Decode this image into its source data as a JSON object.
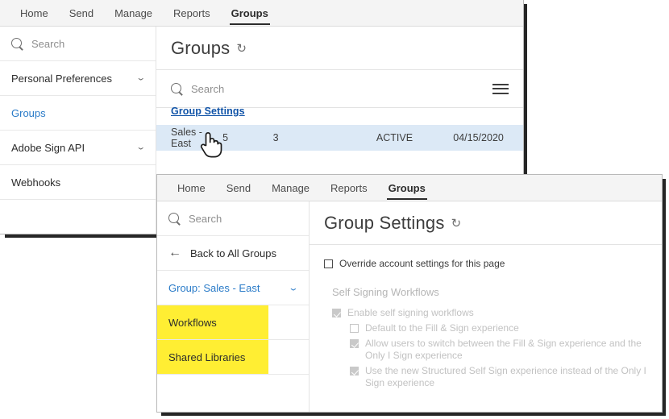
{
  "window_groups": {
    "nav": [
      {
        "label": "Home",
        "active": false
      },
      {
        "label": "Send",
        "active": false
      },
      {
        "label": "Manage",
        "active": false
      },
      {
        "label": "Reports",
        "active": false
      },
      {
        "label": "Groups",
        "active": true
      }
    ],
    "sidebar": {
      "search_placeholder": "Search",
      "items": [
        {
          "label": "Personal Preferences",
          "caret": "⌄",
          "style": "plain"
        },
        {
          "label": "Groups",
          "caret": "",
          "style": "link"
        },
        {
          "label": "Adobe Sign API",
          "caret": "⌄",
          "style": "plain"
        },
        {
          "label": "Webhooks",
          "caret": "",
          "style": "plain"
        }
      ]
    },
    "page_title": "Groups",
    "refresh_icon": "refresh-icon",
    "refresh_glyph": "↻",
    "search_placeholder": "Search",
    "menu_icon": "hamburger-icon",
    "group_settings_link": "Group Settings",
    "table": {
      "rows": [
        {
          "name": "Sales - East",
          "users": "5",
          "agreements": "3",
          "status": "ACTIVE",
          "created": "04/15/2020"
        }
      ]
    },
    "cursor_icon": "pointing-hand-cursor"
  },
  "window_group_settings": {
    "nav": [
      {
        "label": "Home",
        "active": false
      },
      {
        "label": "Send",
        "active": false
      },
      {
        "label": "Manage",
        "active": false
      },
      {
        "label": "Reports",
        "active": false
      },
      {
        "label": "Groups",
        "active": true
      }
    ],
    "sidebar": {
      "search_placeholder": "Search",
      "back_label": "Back to All Groups",
      "back_icon": "arrow-left-icon",
      "group_selector": {
        "label": "Group: Sales - East",
        "caret": "⌄"
      },
      "items": [
        {
          "label": "Workflows",
          "highlight": true
        },
        {
          "label": "Shared Libraries",
          "highlight": true
        }
      ]
    },
    "page_title": "Group Settings",
    "refresh_glyph": "↻",
    "override_checkbox": {
      "label": "Override account settings for this page",
      "checked": false
    },
    "section_title": "Self Signing Workflows",
    "options": [
      {
        "label": "Enable self signing workflows",
        "checked": true,
        "indent": 1
      },
      {
        "label": "Default to the Fill & Sign experience",
        "checked": false,
        "indent": 2
      },
      {
        "label": "Allow users to switch between the Fill & Sign experience and the Only I Sign experience",
        "checked": true,
        "indent": 2
      },
      {
        "label": "Use the new Structured Self Sign experience instead of the Only I Sign experience",
        "checked": true,
        "indent": 2
      }
    ]
  },
  "colors": {
    "accent_blue": "#2a7bc8",
    "link_blue": "#1154a8",
    "highlight_yellow": "#ffee33",
    "selected_row": "#dce9f6",
    "nav_bg": "#f4f4f4"
  }
}
